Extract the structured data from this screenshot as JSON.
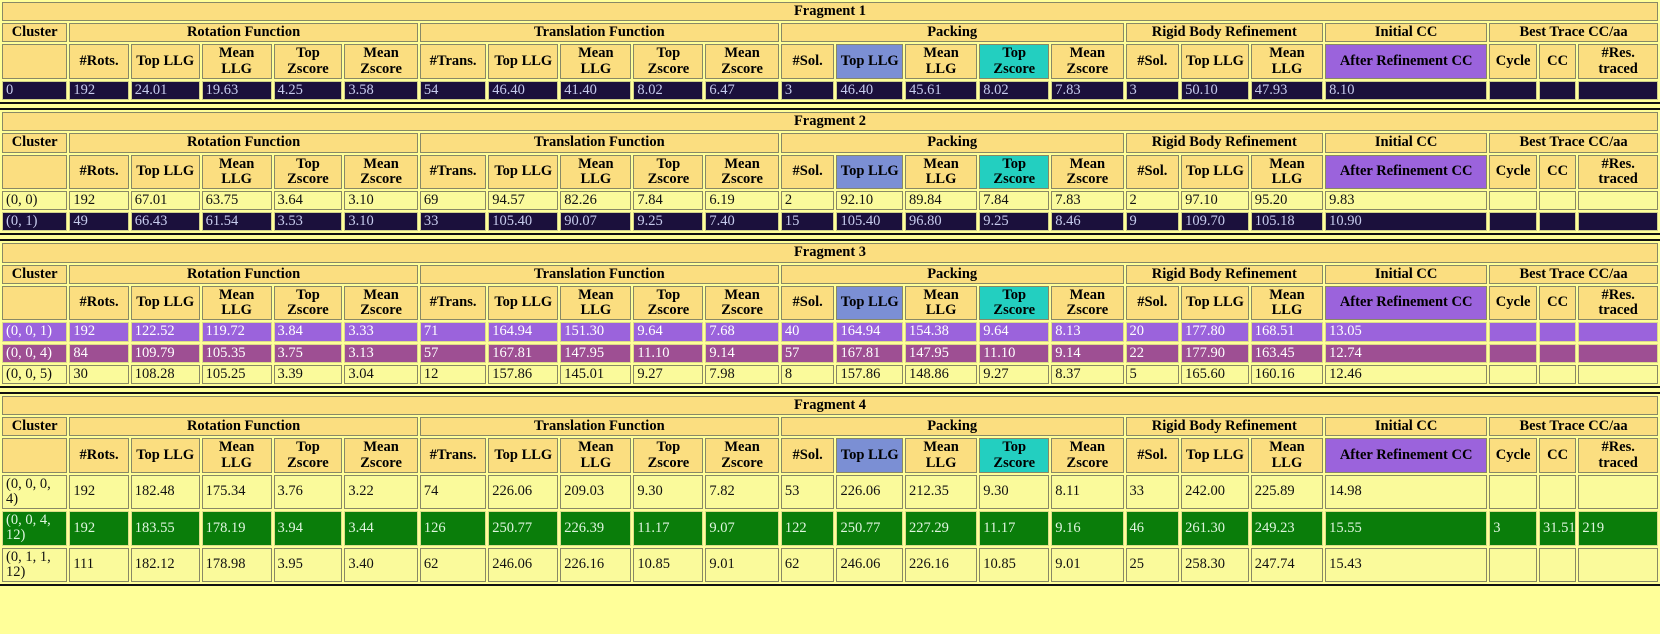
{
  "columns": {
    "group_headers": [
      {
        "label": "Cluster",
        "span": 1
      },
      {
        "label": "Rotation Function",
        "span": 5
      },
      {
        "label": "Translation Function",
        "span": 5
      },
      {
        "label": "Packing",
        "span": 5
      },
      {
        "label": "Rigid Body Refinement",
        "span": 3
      },
      {
        "label": "Initial CC",
        "span": 1
      },
      {
        "label": "Best Trace CC/aa",
        "span": 3
      }
    ],
    "sub_headers": [
      {
        "label": "",
        "key": "cluster",
        "highlight": "none"
      },
      {
        "label": "#Rots.",
        "key": "rf_nrots",
        "highlight": "none"
      },
      {
        "label": "Top LLG",
        "key": "rf_topllg",
        "highlight": "none"
      },
      {
        "label": "Mean LLG",
        "key": "rf_meanllg",
        "highlight": "none"
      },
      {
        "label": "Top Zscore",
        "key": "rf_topz",
        "highlight": "none"
      },
      {
        "label": "Mean Zscore",
        "key": "rf_meanz",
        "highlight": "none"
      },
      {
        "label": "#Trans.",
        "key": "tf_ntrans",
        "highlight": "none"
      },
      {
        "label": "Top LLG",
        "key": "tf_topllg",
        "highlight": "none"
      },
      {
        "label": "Mean LLG",
        "key": "tf_meanllg",
        "highlight": "none"
      },
      {
        "label": "Top Zscore",
        "key": "tf_topz",
        "highlight": "none"
      },
      {
        "label": "Mean Zscore",
        "key": "tf_meanz",
        "highlight": "none"
      },
      {
        "label": "#Sol.",
        "key": "pk_nsol",
        "highlight": "none"
      },
      {
        "label": "Top LLG",
        "key": "pk_topllg",
        "highlight": "blue"
      },
      {
        "label": "Mean LLG",
        "key": "pk_meanllg",
        "highlight": "none"
      },
      {
        "label": "Top Zscore",
        "key": "pk_topz",
        "highlight": "cyan"
      },
      {
        "label": "Mean Zscore",
        "key": "pk_meanz",
        "highlight": "none"
      },
      {
        "label": "#Sol.",
        "key": "rb_nsol",
        "highlight": "none"
      },
      {
        "label": "Top LLG",
        "key": "rb_topllg",
        "highlight": "none"
      },
      {
        "label": "Mean LLG",
        "key": "rb_meanllg",
        "highlight": "none"
      },
      {
        "label": "After Refinement CC",
        "key": "init_cc",
        "highlight": "purple"
      },
      {
        "label": "Cycle",
        "key": "bt_cycle",
        "highlight": "none"
      },
      {
        "label": "CC",
        "key": "bt_cc",
        "highlight": "none"
      },
      {
        "label": "#Res. traced",
        "key": "bt_res",
        "highlight": "none"
      }
    ]
  },
  "colors": {
    "page_background": "#FFFF99",
    "header_background": "#FBDE80",
    "highlight_blue": "#7B8FD4",
    "highlight_cyan": "#23CFC0",
    "highlight_purple": "#9B63DC",
    "row_navy": "#1B103C",
    "row_yellow": "#FAFA9B",
    "row_purple": "#9B63DC",
    "row_plum": "#9E4F93",
    "row_green": "#0A7D0A"
  },
  "fragments": [
    {
      "title": "Fragment 1",
      "rows": [
        {
          "style": "navy",
          "cluster": "0",
          "rf_nrots": "192",
          "rf_topllg": "24.01",
          "rf_meanllg": "19.63",
          "rf_topz": "4.25",
          "rf_meanz": "3.58",
          "tf_ntrans": "54",
          "tf_topllg": "46.40",
          "tf_meanllg": "41.40",
          "tf_topz": "8.02",
          "tf_meanz": "6.47",
          "pk_nsol": "3",
          "pk_topllg": "46.40",
          "pk_meanllg": "45.61",
          "pk_topz": "8.02",
          "pk_meanz": "7.83",
          "rb_nsol": "3",
          "rb_topllg": "50.10",
          "rb_meanllg": "47.93",
          "init_cc": "8.10",
          "bt_cycle": "",
          "bt_cc": "",
          "bt_res": ""
        }
      ]
    },
    {
      "title": "Fragment 2",
      "rows": [
        {
          "style": "yellow",
          "cluster": "(0, 0)",
          "rf_nrots": "192",
          "rf_topllg": "67.01",
          "rf_meanllg": "63.75",
          "rf_topz": "3.64",
          "rf_meanz": "3.10",
          "tf_ntrans": "69",
          "tf_topllg": "94.57",
          "tf_meanllg": "82.26",
          "tf_topz": "7.84",
          "tf_meanz": "6.19",
          "pk_nsol": "2",
          "pk_topllg": "92.10",
          "pk_meanllg": "89.84",
          "pk_topz": "7.84",
          "pk_meanz": "7.83",
          "rb_nsol": "2",
          "rb_topllg": "97.10",
          "rb_meanllg": "95.20",
          "init_cc": "9.83",
          "bt_cycle": "",
          "bt_cc": "",
          "bt_res": ""
        },
        {
          "style": "navy",
          "cluster": "(0, 1)",
          "rf_nrots": "49",
          "rf_topllg": "66.43",
          "rf_meanllg": "61.54",
          "rf_topz": "3.53",
          "rf_meanz": "3.10",
          "tf_ntrans": "33",
          "tf_topllg": "105.40",
          "tf_meanllg": "90.07",
          "tf_topz": "9.25",
          "tf_meanz": "7.40",
          "pk_nsol": "15",
          "pk_topllg": "105.40",
          "pk_meanllg": "96.80",
          "pk_topz": "9.25",
          "pk_meanz": "8.46",
          "rb_nsol": "9",
          "rb_topllg": "109.70",
          "rb_meanllg": "105.18",
          "init_cc": "10.90",
          "bt_cycle": "",
          "bt_cc": "",
          "bt_res": ""
        }
      ]
    },
    {
      "title": "Fragment 3",
      "rows": [
        {
          "style": "purple",
          "cluster": "(0, 0, 1)",
          "rf_nrots": "192",
          "rf_topllg": "122.52",
          "rf_meanllg": "119.72",
          "rf_topz": "3.84",
          "rf_meanz": "3.33",
          "tf_ntrans": "71",
          "tf_topllg": "164.94",
          "tf_meanllg": "151.30",
          "tf_topz": "9.64",
          "tf_meanz": "7.68",
          "pk_nsol": "40",
          "pk_topllg": "164.94",
          "pk_meanllg": "154.38",
          "pk_topz": "9.64",
          "pk_meanz": "8.13",
          "rb_nsol": "20",
          "rb_topllg": "177.80",
          "rb_meanllg": "168.51",
          "init_cc": "13.05",
          "bt_cycle": "",
          "bt_cc": "",
          "bt_res": ""
        },
        {
          "style": "plum",
          "cluster": "(0, 0, 4)",
          "rf_nrots": "84",
          "rf_topllg": "109.79",
          "rf_meanllg": "105.35",
          "rf_topz": "3.75",
          "rf_meanz": "3.13",
          "tf_ntrans": "57",
          "tf_topllg": "167.81",
          "tf_meanllg": "147.95",
          "tf_topz": "11.10",
          "tf_meanz": "9.14",
          "pk_nsol": "57",
          "pk_topllg": "167.81",
          "pk_meanllg": "147.95",
          "pk_topz": "11.10",
          "pk_meanz": "9.14",
          "rb_nsol": "22",
          "rb_topllg": "177.90",
          "rb_meanllg": "163.45",
          "init_cc": "12.74",
          "bt_cycle": "",
          "bt_cc": "",
          "bt_res": ""
        },
        {
          "style": "yellow",
          "cluster": "(0, 0, 5)",
          "rf_nrots": "30",
          "rf_topllg": "108.28",
          "rf_meanllg": "105.25",
          "rf_topz": "3.39",
          "rf_meanz": "3.04",
          "tf_ntrans": "12",
          "tf_topllg": "157.86",
          "tf_meanllg": "145.01",
          "tf_topz": "9.27",
          "tf_meanz": "7.98",
          "pk_nsol": "8",
          "pk_topllg": "157.86",
          "pk_meanllg": "148.86",
          "pk_topz": "9.27",
          "pk_meanz": "8.37",
          "rb_nsol": "5",
          "rb_topllg": "165.60",
          "rb_meanllg": "160.16",
          "init_cc": "12.46",
          "bt_cycle": "",
          "bt_cc": "",
          "bt_res": ""
        }
      ]
    },
    {
      "title": "Fragment 4",
      "rows": [
        {
          "style": "yellow",
          "cluster": "(0, 0, 0, 4)",
          "rf_nrots": "192",
          "rf_topllg": "182.48",
          "rf_meanllg": "175.34",
          "rf_topz": "3.76",
          "rf_meanz": "3.22",
          "tf_ntrans": "74",
          "tf_topllg": "226.06",
          "tf_meanllg": "209.03",
          "tf_topz": "9.30",
          "tf_meanz": "7.82",
          "pk_nsol": "53",
          "pk_topllg": "226.06",
          "pk_meanllg": "212.35",
          "pk_topz": "9.30",
          "pk_meanz": "8.11",
          "rb_nsol": "33",
          "rb_topllg": "242.00",
          "rb_meanllg": "225.89",
          "init_cc": "14.98",
          "bt_cycle": "",
          "bt_cc": "",
          "bt_res": ""
        },
        {
          "style": "green",
          "cluster": "(0, 0, 4, 12)",
          "rf_nrots": "192",
          "rf_topllg": "183.55",
          "rf_meanllg": "178.19",
          "rf_topz": "3.94",
          "rf_meanz": "3.44",
          "tf_ntrans": "126",
          "tf_topllg": "250.77",
          "tf_meanllg": "226.39",
          "tf_topz": "11.17",
          "tf_meanz": "9.07",
          "pk_nsol": "122",
          "pk_topllg": "250.77",
          "pk_meanllg": "227.29",
          "pk_topz": "11.17",
          "pk_meanz": "9.16",
          "rb_nsol": "46",
          "rb_topllg": "261.30",
          "rb_meanllg": "249.23",
          "init_cc": "15.55",
          "bt_cycle": "3",
          "bt_cc": "31.51",
          "bt_res": "219"
        },
        {
          "style": "yellow",
          "cluster": "(0, 1, 1, 12)",
          "rf_nrots": "111",
          "rf_topllg": "182.12",
          "rf_meanllg": "178.98",
          "rf_topz": "3.95",
          "rf_meanz": "3.40",
          "tf_ntrans": "62",
          "tf_topllg": "246.06",
          "tf_meanllg": "226.16",
          "tf_topz": "10.85",
          "tf_meanz": "9.01",
          "pk_nsol": "62",
          "pk_topllg": "246.06",
          "pk_meanllg": "226.16",
          "pk_topz": "10.85",
          "pk_meanz": "9.01",
          "rb_nsol": "25",
          "rb_topllg": "258.30",
          "rb_meanllg": "247.74",
          "init_cc": "15.43",
          "bt_cycle": "",
          "bt_cc": "",
          "bt_res": ""
        }
      ]
    }
  ]
}
